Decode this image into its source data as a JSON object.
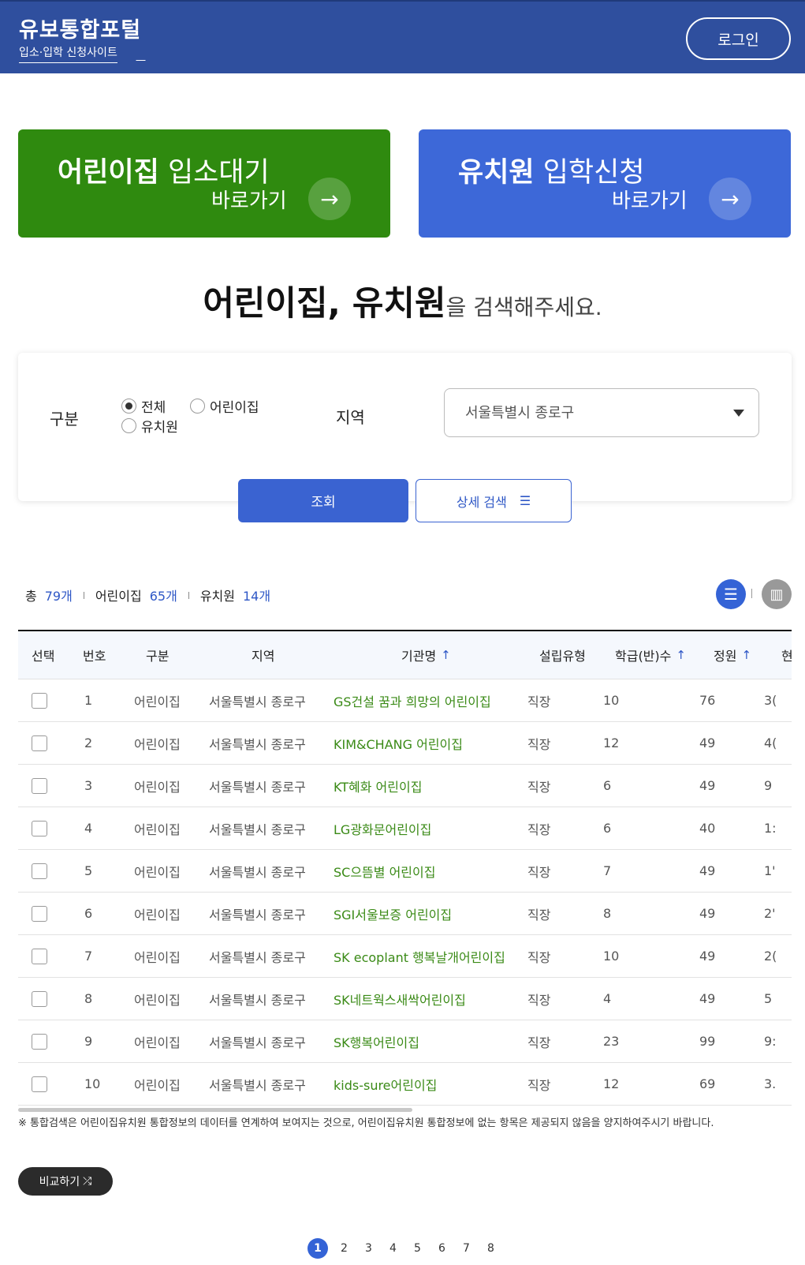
{
  "header": {
    "title": "유보통합포털",
    "subtitle": "입소·입학 신청사이트",
    "login_label": "로그인"
  },
  "banners": [
    {
      "title_bold": "어린이집",
      "title_rest": " 입소대기",
      "go_label": "바로가기",
      "color": "#2f8a0f"
    },
    {
      "title_bold": "유치원",
      "title_rest": " 입학신청",
      "go_label": "바로가기",
      "color": "#3d68d8"
    }
  ],
  "search": {
    "heading_bold": "어린이집, 유치원",
    "heading_rest": "을 검색해주세요.",
    "type_label": "구분",
    "type_options": [
      "전체",
      "어린이집",
      "유치원"
    ],
    "type_selected": "전체",
    "region_label": "지역",
    "region_value": "서울특별시 종로구",
    "search_button": "조회",
    "detail_button": "상세 검색"
  },
  "counts": {
    "total_label": "총",
    "total": "79개",
    "daycare_label": "어린이집",
    "daycare": "65개",
    "kindergarten_label": "유치원",
    "kindergarten": "14개"
  },
  "table": {
    "columns": [
      "선택",
      "번호",
      "구분",
      "지역",
      "기관명",
      "설립유형",
      "학급(반)수",
      "정원",
      "현"
    ],
    "sortable": [
      "기관명",
      "학급(반)수",
      "정원"
    ],
    "rows": [
      {
        "no": "1",
        "type": "어린이집",
        "region": "서울특별시 종로구",
        "name": "GS건설 꿈과 희망의 어린이집",
        "est": "직장",
        "classes": "10",
        "capacity": "76",
        "current": "3("
      },
      {
        "no": "2",
        "type": "어린이집",
        "region": "서울특별시 종로구",
        "name": "KIM&CHANG 어린이집",
        "est": "직장",
        "classes": "12",
        "capacity": "49",
        "current": "4("
      },
      {
        "no": "3",
        "type": "어린이집",
        "region": "서울특별시 종로구",
        "name": "KT혜화 어린이집",
        "est": "직장",
        "classes": "6",
        "capacity": "49",
        "current": "9"
      },
      {
        "no": "4",
        "type": "어린이집",
        "region": "서울특별시 종로구",
        "name": "LG광화문어린이집",
        "est": "직장",
        "classes": "6",
        "capacity": "40",
        "current": "1:"
      },
      {
        "no": "5",
        "type": "어린이집",
        "region": "서울특별시 종로구",
        "name": "SC으뜸별 어린이집",
        "est": "직장",
        "classes": "7",
        "capacity": "49",
        "current": "1'"
      },
      {
        "no": "6",
        "type": "어린이집",
        "region": "서울특별시 종로구",
        "name": "SGI서울보증 어린이집",
        "est": "직장",
        "classes": "8",
        "capacity": "49",
        "current": "2'"
      },
      {
        "no": "7",
        "type": "어린이집",
        "region": "서울특별시 종로구",
        "name": "SK ecoplant 행복날개어린이집",
        "est": "직장",
        "classes": "10",
        "capacity": "49",
        "current": "2("
      },
      {
        "no": "8",
        "type": "어린이집",
        "region": "서울특별시 종로구",
        "name": "SK네트웍스새싹어린이집",
        "est": "직장",
        "classes": "4",
        "capacity": "49",
        "current": "5"
      },
      {
        "no": "9",
        "type": "어린이집",
        "region": "서울특별시 종로구",
        "name": "SK행복어린이집",
        "est": "직장",
        "classes": "23",
        "capacity": "99",
        "current": "9:"
      },
      {
        "no": "10",
        "type": "어린이집",
        "region": "서울특별시 종로구",
        "name": "kids-sure어린이집",
        "est": "직장",
        "classes": "12",
        "capacity": "69",
        "current": "3."
      }
    ]
  },
  "note": "※ 통합검색은 어린이집유치원 통합정보의 데이터를 연계하여 보여지는 것으로, 어린이집유치원 통합정보에 없는 항목은 제공되지 않음을 양지하여주시기 바랍니다.",
  "compare_button": "비교하기",
  "pagination": {
    "current": "1",
    "pages": [
      "1",
      "2",
      "3",
      "4",
      "5",
      "6",
      "7",
      "8"
    ]
  },
  "icons": {
    "arrow": "arrow-right-icon",
    "list": "list-view-icon",
    "map": "map-view-icon",
    "sliders": "sliders-icon",
    "shuffle": "shuffle-icon"
  }
}
